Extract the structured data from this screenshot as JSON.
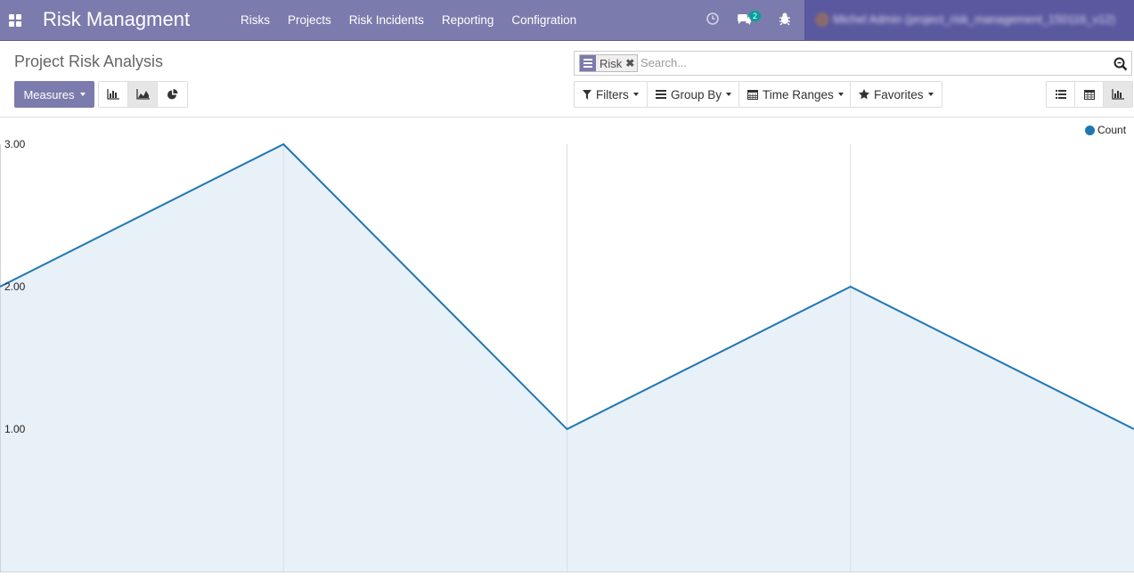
{
  "navbar": {
    "app_title": "Risk Managment",
    "menu": [
      "Risks",
      "Projects",
      "Risk Incidents",
      "Reporting",
      "Configration"
    ],
    "message_count": "2",
    "user_name": "Michel Admin (project_risk_management_150116_v12)"
  },
  "control_panel": {
    "breadcrumb": "Project Risk Analysis",
    "facet_label": "Risk",
    "search_placeholder": "Search...",
    "measures_label": "Measures",
    "filters_label": "Filters",
    "group_by_label": "Group By",
    "time_ranges_label": "Time Ranges",
    "favorites_label": "Favorites"
  },
  "colors": {
    "brand": "#7c7bad",
    "series": "#1f77b4",
    "area_fill": "#e8f0f8"
  },
  "chart_data": {
    "type": "area",
    "x": [
      "",
      "",
      "",
      "",
      ""
    ],
    "series": [
      {
        "name": "Count",
        "values": [
          2,
          3,
          1,
          2,
          1
        ]
      }
    ],
    "ylim": [
      0,
      3
    ],
    "y_ticks": [
      "1.00",
      "2.00",
      "3.00"
    ],
    "grid": true,
    "legend": "top-right"
  }
}
